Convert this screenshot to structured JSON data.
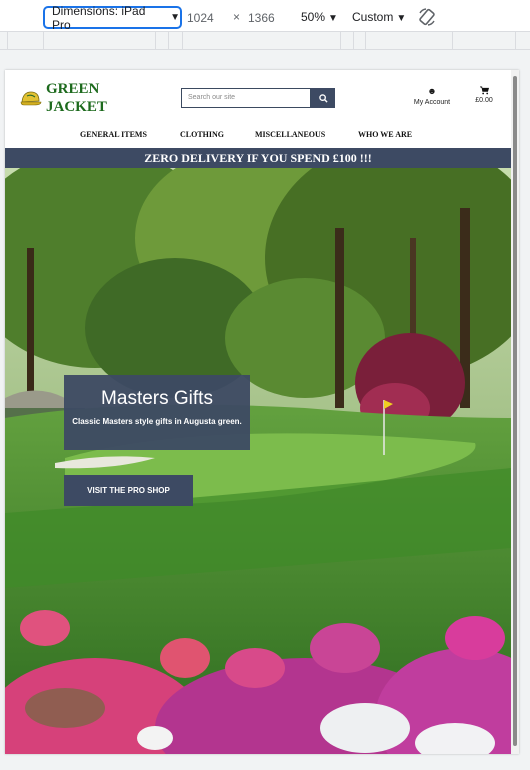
{
  "devtools": {
    "dimensions_label": "Dimensions: iPad Pro",
    "width": "1024",
    "times": "×",
    "height": "1366",
    "zoom": "50%",
    "throttle": "Custom",
    "icons": [
      "chevron-down-icon",
      "rotate-icon"
    ]
  },
  "site": {
    "logo": "GREEN JACKET",
    "search_placeholder": "Search our site",
    "account_label": "My Account",
    "cart_total": "£0.00",
    "nav": [
      "GENERAL ITEMS",
      "CLOTHING",
      "MISCELLANEOUS",
      "WHO WE ARE"
    ],
    "promo": "ZERO DELIVERY IF YOU SPEND £100 !!!",
    "hero": {
      "title": "Masters Gifts",
      "subtitle": "Classic Masters style gifts in Augusta green.",
      "cta": "VISIT THE PRO SHOP"
    },
    "colors": {
      "brand_green": "#1d6a1d",
      "navy": "#3d4a63",
      "devtools_blue": "#1a73e8"
    }
  }
}
